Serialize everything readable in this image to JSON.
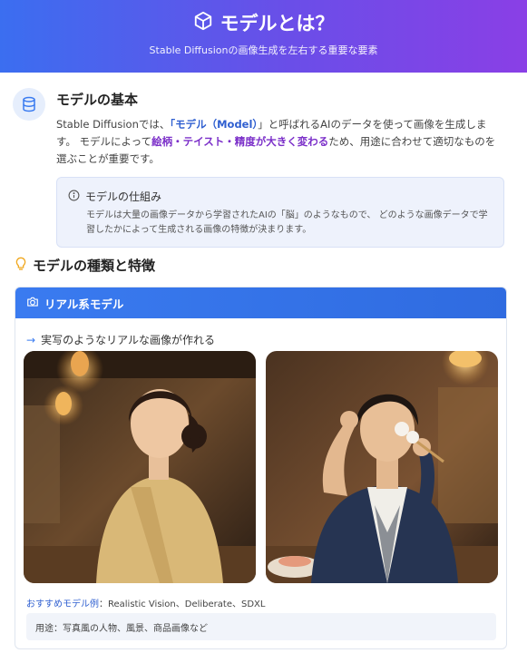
{
  "header": {
    "title": "モデルとは？",
    "subtitle": "Stable Diffusionの画像生成を左右する重要な要素",
    "gradient": [
      "#3b6ef0",
      "#8a3fe6"
    ]
  },
  "basics": {
    "title": "モデルの基本",
    "p1_a": "Stable Diffusionでは、",
    "p1_model": "「モデル（Model）",
    "p1_b": "」と呼ばれるAIのデータを使って画像を生成します。 モデルによって",
    "p1_emph": "絵柄・テイスト・精度が大きく変わる",
    "p1_c": "ため、用途に合わせて適切なものを選ぶことが重要です。",
    "info": {
      "title": "モデルの仕組み",
      "body": "モデルは大量の画像データから学習されたAIの「脳」のようなもので、 どのような画像データで学習したかによって生成される画像の特徴が決まります。"
    }
  },
  "types": {
    "title": "モデルの種類と特徴",
    "card": {
      "title": "リアル系モデル",
      "lead": "実写のようなリアルな画像が作れる",
      "rec_label": "おすすめモデル例",
      "rec_value": "：Realistic Vision、Deliberate、SDXL",
      "usage": "用途：写真風の人物、風景、商品画像など"
    }
  },
  "colors": {
    "accent": "#3a7bf0",
    "purple": "#7b2fc9",
    "blue_text": "#2f5fd0"
  }
}
